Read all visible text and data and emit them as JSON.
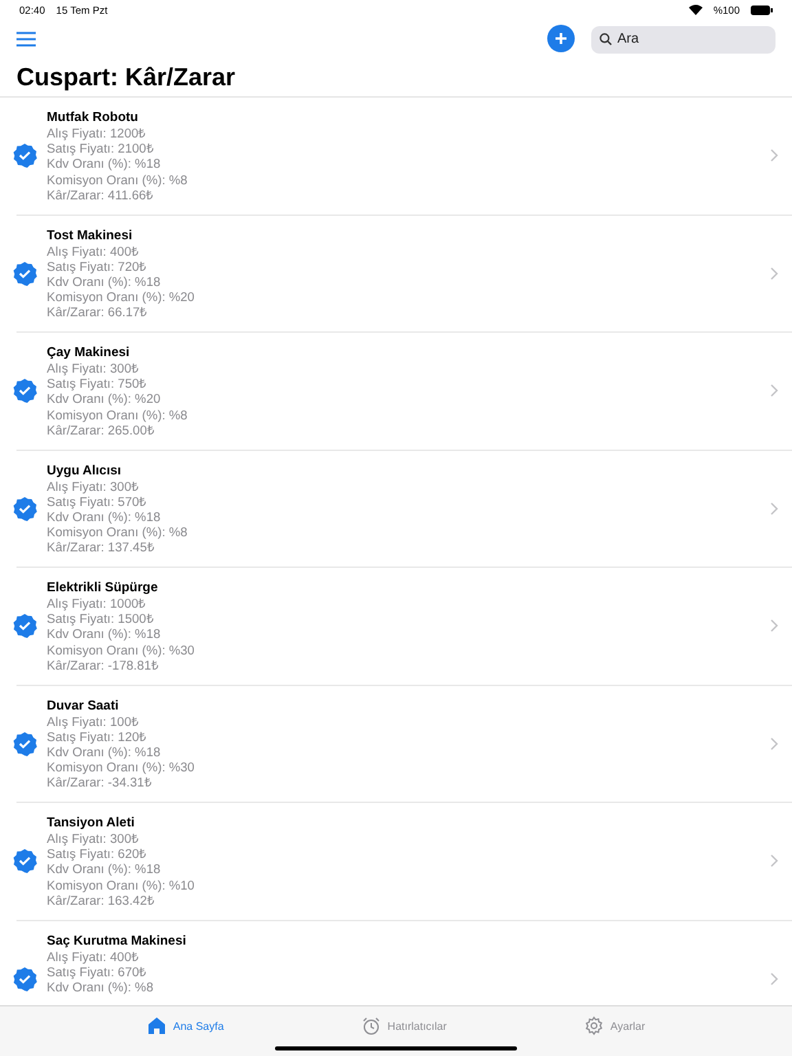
{
  "status_bar": {
    "time": "02:40",
    "date": "15 Tem Pzt",
    "battery": "%100"
  },
  "toolbar": {
    "search": {
      "placeholder": "Ara"
    }
  },
  "title": "Cuspart: Kâr/Zarar",
  "products": [
    {
      "name": "Mutfak Robotu",
      "checked": true,
      "lines": [
        "Alış Fiyatı: 1200₺",
        "Satış Fiyatı: 2100₺",
        "Kdv Oranı (%): %18",
        "Komisyon Oranı (%): %8",
        "Kâr/Zarar: 411.66₺"
      ]
    },
    {
      "name": "Tost Makinesi",
      "checked": true,
      "lines": [
        "Alış Fiyatı: 400₺",
        "Satış Fiyatı: 720₺",
        "Kdv Oranı (%): %18",
        "Komisyon Oranı (%): %20",
        "Kâr/Zarar: 66.17₺"
      ]
    },
    {
      "name": "Çay Makinesi",
      "checked": true,
      "lines": [
        "Alış Fiyatı: 300₺",
        "Satış Fiyatı: 750₺",
        "Kdv Oranı (%): %20",
        "Komisyon Oranı (%): %8",
        "Kâr/Zarar: 265.00₺"
      ]
    },
    {
      "name": "Uygu Alıcısı",
      "checked": true,
      "lines": [
        "Alış Fiyatı: 300₺",
        "Satış Fiyatı: 570₺",
        "Kdv Oranı (%): %18",
        "Komisyon Oranı (%): %8",
        "Kâr/Zarar: 137.45₺"
      ]
    },
    {
      "name": "Elektrikli Süpürge",
      "checked": true,
      "lines": [
        "Alış Fiyatı: 1000₺",
        "Satış Fiyatı: 1500₺",
        "Kdv Oranı (%): %18",
        "Komisyon Oranı (%): %30",
        "Kâr/Zarar: -178.81₺"
      ]
    },
    {
      "name": "Duvar Saati",
      "checked": true,
      "lines": [
        "Alış Fiyatı: 100₺",
        "Satış Fiyatı: 120₺",
        "Kdv Oranı (%): %18",
        "Komisyon Oranı (%): %30",
        "Kâr/Zarar: -34.31₺"
      ]
    },
    {
      "name": "Tansiyon Aleti",
      "checked": true,
      "lines": [
        "Alış Fiyatı: 300₺",
        "Satış Fiyatı: 620₺",
        "Kdv Oranı (%): %18",
        "Komisyon Oranı (%): %10",
        "Kâr/Zarar: 163.42₺"
      ]
    },
    {
      "name": "Saç Kurutma Makinesi",
      "checked": true,
      "lines": [
        "Alış Fiyatı: 400₺",
        "Satış Fiyatı: 670₺",
        "Kdv Oranı (%): %8"
      ]
    }
  ],
  "tab_bar": [
    {
      "kind": "home",
      "label": "Ana Sayfa",
      "selected": true
    },
    {
      "kind": "alarm",
      "label": "Hatırlatıcılar",
      "selected": false
    },
    {
      "kind": "gear",
      "label": "Ayarlar",
      "selected": false
    }
  ]
}
